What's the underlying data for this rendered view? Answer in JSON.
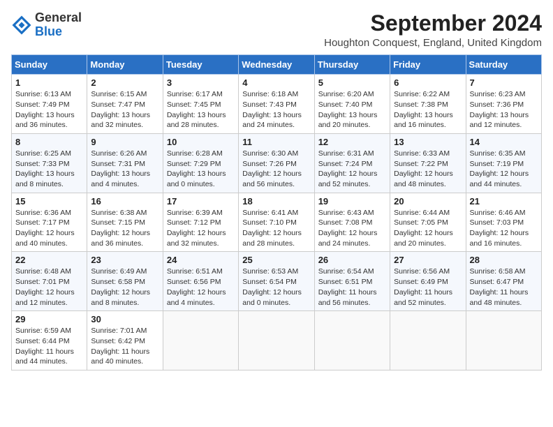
{
  "header": {
    "logo_general": "General",
    "logo_blue": "Blue",
    "month_year": "September 2024",
    "location": "Houghton Conquest, England, United Kingdom"
  },
  "weekdays": [
    "Sunday",
    "Monday",
    "Tuesday",
    "Wednesday",
    "Thursday",
    "Friday",
    "Saturday"
  ],
  "weeks": [
    [
      {
        "day": "1",
        "info": "Sunrise: 6:13 AM\nSunset: 7:49 PM\nDaylight: 13 hours\nand 36 minutes."
      },
      {
        "day": "2",
        "info": "Sunrise: 6:15 AM\nSunset: 7:47 PM\nDaylight: 13 hours\nand 32 minutes."
      },
      {
        "day": "3",
        "info": "Sunrise: 6:17 AM\nSunset: 7:45 PM\nDaylight: 13 hours\nand 28 minutes."
      },
      {
        "day": "4",
        "info": "Sunrise: 6:18 AM\nSunset: 7:43 PM\nDaylight: 13 hours\nand 24 minutes."
      },
      {
        "day": "5",
        "info": "Sunrise: 6:20 AM\nSunset: 7:40 PM\nDaylight: 13 hours\nand 20 minutes."
      },
      {
        "day": "6",
        "info": "Sunrise: 6:22 AM\nSunset: 7:38 PM\nDaylight: 13 hours\nand 16 minutes."
      },
      {
        "day": "7",
        "info": "Sunrise: 6:23 AM\nSunset: 7:36 PM\nDaylight: 13 hours\nand 12 minutes."
      }
    ],
    [
      {
        "day": "8",
        "info": "Sunrise: 6:25 AM\nSunset: 7:33 PM\nDaylight: 13 hours\nand 8 minutes."
      },
      {
        "day": "9",
        "info": "Sunrise: 6:26 AM\nSunset: 7:31 PM\nDaylight: 13 hours\nand 4 minutes."
      },
      {
        "day": "10",
        "info": "Sunrise: 6:28 AM\nSunset: 7:29 PM\nDaylight: 13 hours\nand 0 minutes."
      },
      {
        "day": "11",
        "info": "Sunrise: 6:30 AM\nSunset: 7:26 PM\nDaylight: 12 hours\nand 56 minutes."
      },
      {
        "day": "12",
        "info": "Sunrise: 6:31 AM\nSunset: 7:24 PM\nDaylight: 12 hours\nand 52 minutes."
      },
      {
        "day": "13",
        "info": "Sunrise: 6:33 AM\nSunset: 7:22 PM\nDaylight: 12 hours\nand 48 minutes."
      },
      {
        "day": "14",
        "info": "Sunrise: 6:35 AM\nSunset: 7:19 PM\nDaylight: 12 hours\nand 44 minutes."
      }
    ],
    [
      {
        "day": "15",
        "info": "Sunrise: 6:36 AM\nSunset: 7:17 PM\nDaylight: 12 hours\nand 40 minutes."
      },
      {
        "day": "16",
        "info": "Sunrise: 6:38 AM\nSunset: 7:15 PM\nDaylight: 12 hours\nand 36 minutes."
      },
      {
        "day": "17",
        "info": "Sunrise: 6:39 AM\nSunset: 7:12 PM\nDaylight: 12 hours\nand 32 minutes."
      },
      {
        "day": "18",
        "info": "Sunrise: 6:41 AM\nSunset: 7:10 PM\nDaylight: 12 hours\nand 28 minutes."
      },
      {
        "day": "19",
        "info": "Sunrise: 6:43 AM\nSunset: 7:08 PM\nDaylight: 12 hours\nand 24 minutes."
      },
      {
        "day": "20",
        "info": "Sunrise: 6:44 AM\nSunset: 7:05 PM\nDaylight: 12 hours\nand 20 minutes."
      },
      {
        "day": "21",
        "info": "Sunrise: 6:46 AM\nSunset: 7:03 PM\nDaylight: 12 hours\nand 16 minutes."
      }
    ],
    [
      {
        "day": "22",
        "info": "Sunrise: 6:48 AM\nSunset: 7:01 PM\nDaylight: 12 hours\nand 12 minutes."
      },
      {
        "day": "23",
        "info": "Sunrise: 6:49 AM\nSunset: 6:58 PM\nDaylight: 12 hours\nand 8 minutes."
      },
      {
        "day": "24",
        "info": "Sunrise: 6:51 AM\nSunset: 6:56 PM\nDaylight: 12 hours\nand 4 minutes."
      },
      {
        "day": "25",
        "info": "Sunrise: 6:53 AM\nSunset: 6:54 PM\nDaylight: 12 hours\nand 0 minutes."
      },
      {
        "day": "26",
        "info": "Sunrise: 6:54 AM\nSunset: 6:51 PM\nDaylight: 11 hours\nand 56 minutes."
      },
      {
        "day": "27",
        "info": "Sunrise: 6:56 AM\nSunset: 6:49 PM\nDaylight: 11 hours\nand 52 minutes."
      },
      {
        "day": "28",
        "info": "Sunrise: 6:58 AM\nSunset: 6:47 PM\nDaylight: 11 hours\nand 48 minutes."
      }
    ],
    [
      {
        "day": "29",
        "info": "Sunrise: 6:59 AM\nSunset: 6:44 PM\nDaylight: 11 hours\nand 44 minutes."
      },
      {
        "day": "30",
        "info": "Sunrise: 7:01 AM\nSunset: 6:42 PM\nDaylight: 11 hours\nand 40 minutes."
      },
      {
        "day": "",
        "info": ""
      },
      {
        "day": "",
        "info": ""
      },
      {
        "day": "",
        "info": ""
      },
      {
        "day": "",
        "info": ""
      },
      {
        "day": "",
        "info": ""
      }
    ]
  ]
}
